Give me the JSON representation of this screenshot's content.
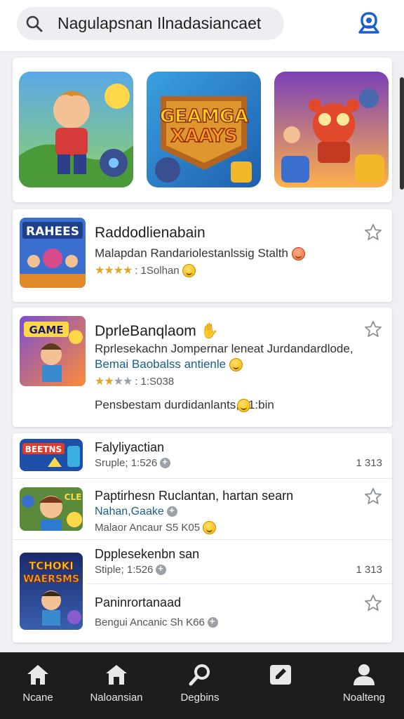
{
  "search": {
    "value": "Nagulapsnan Ilnadasiancaet",
    "placeholder": ""
  },
  "header": {
    "account_icon": "account-icon"
  },
  "carousel": {
    "items": [
      {
        "name": "carousel-game-hero",
        "title": ""
      },
      {
        "name": "carousel-game-logo",
        "title": "GEAMGA XAAYS"
      },
      {
        "name": "carousel-game-robot",
        "title": ""
      }
    ]
  },
  "featured": [
    {
      "thumb_text": "RAHEES",
      "title": "Raddodlienabain",
      "subtitle": "Malapdan Randariolestanlssig Stalth",
      "rating": 4,
      "rating_text": "1Solhan"
    },
    {
      "thumb_text": "GAME",
      "title": "DprleBanqlaom",
      "subtitle": "Rprlesekachn Jompernar leneat Jurdandardlode,",
      "subtitle2": "Bemai Baobalss antienle",
      "rating": 2.5,
      "rating_text": "1:S038",
      "footer_text": "Pensbestam durdidanlants, 11:bin"
    }
  ],
  "list": [
    {
      "thumb_text": "BEETNS",
      "title": "Falyliyactian",
      "meta": "Sruple; 1:526",
      "count": "1 313"
    },
    {
      "thumb_text": "CLE",
      "title": "Paptirhesn Ruclantan,  hartan searn",
      "sub": "Nahan,Gaake",
      "meta": "Malaor Ancaur  S5 K05"
    },
    {
      "thumb_text": "TCHOKI WAERSMS",
      "title": "Dpplesekenbn san",
      "meta": "Stiple; 1:526",
      "count": "1 313"
    },
    {
      "title": "Paninrortanaad",
      "meta": "Bengui Ancanic  Sh K66"
    }
  ],
  "bottom_nav": [
    {
      "label": "Ncane",
      "icon": "home-icon"
    },
    {
      "label": "Naloansian",
      "icon": "store-icon"
    },
    {
      "label": "Degbins",
      "icon": "search-icon"
    },
    {
      "label": "",
      "icon": "edit-icon"
    },
    {
      "label": "Noalteng",
      "icon": "profile-icon"
    }
  ],
  "colors": {
    "accent": "#1a5fd1",
    "nav_bg": "#1d1d1f",
    "star": "#e0a62a",
    "subtitle_blue": "#1a5f8a"
  }
}
